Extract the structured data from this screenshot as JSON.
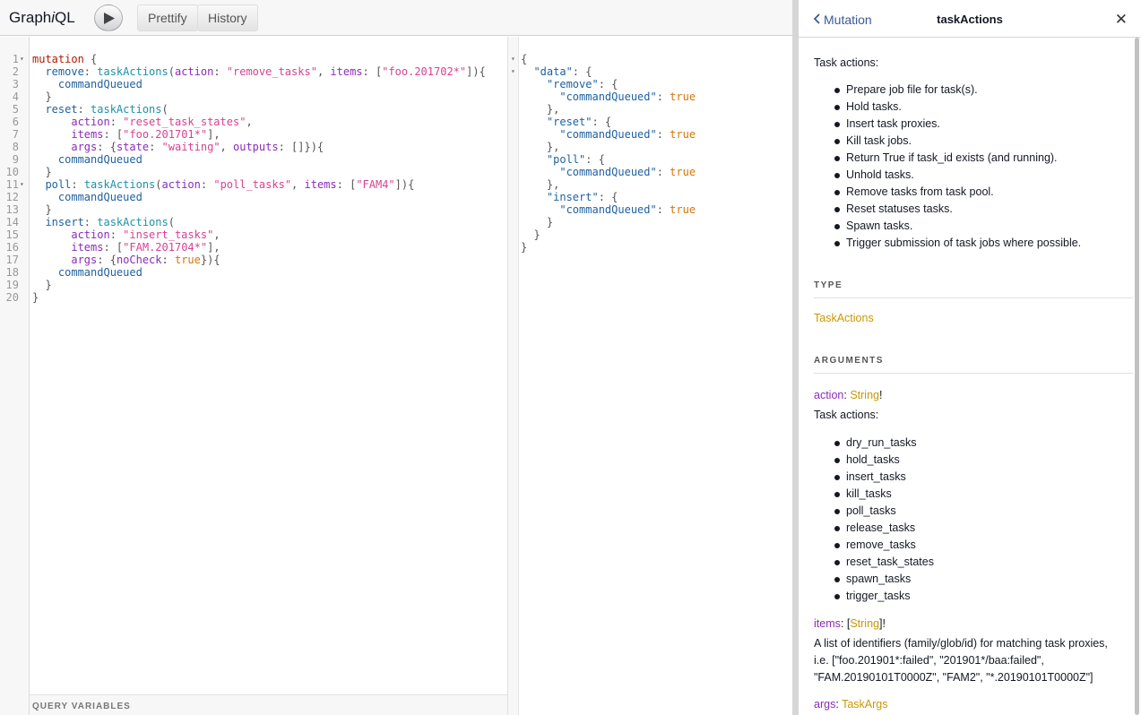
{
  "toolbar": {
    "logo_prefix": "Graph",
    "logo_italic": "i",
    "logo_suffix": "QL",
    "prettify_label": "Prettify",
    "history_label": "History"
  },
  "query": {
    "lines": [
      [
        [
          "kw",
          "mutation"
        ],
        [
          "punc",
          " {"
        ]
      ],
      [
        [
          "field",
          "  remove"
        ],
        [
          "punc",
          ": "
        ],
        [
          "fn",
          "taskActions"
        ],
        [
          "punc",
          "("
        ],
        [
          "arg",
          "action"
        ],
        [
          "punc",
          ": "
        ],
        [
          "str",
          "\"remove_tasks\""
        ],
        [
          "punc",
          ", "
        ],
        [
          "arg",
          "items"
        ],
        [
          "punc",
          ": ["
        ],
        [
          "str",
          "\"foo.201702*\""
        ],
        [
          "punc",
          "]){"
        ]
      ],
      [
        [
          "field",
          "    commandQueued"
        ]
      ],
      [
        [
          "punc",
          "  }"
        ]
      ],
      [
        [
          "field",
          "  reset"
        ],
        [
          "punc",
          ": "
        ],
        [
          "fn",
          "taskActions"
        ],
        [
          "punc",
          "("
        ]
      ],
      [
        [
          "arg",
          "      action"
        ],
        [
          "punc",
          ": "
        ],
        [
          "str",
          "\"reset_task_states\""
        ],
        [
          "punc",
          ","
        ]
      ],
      [
        [
          "arg",
          "      items"
        ],
        [
          "punc",
          ": ["
        ],
        [
          "str",
          "\"foo.201701*\""
        ],
        [
          "punc",
          "],"
        ]
      ],
      [
        [
          "arg",
          "      args"
        ],
        [
          "punc",
          ": {"
        ],
        [
          "arg",
          "state"
        ],
        [
          "punc",
          ": "
        ],
        [
          "str",
          "\"waiting\""
        ],
        [
          "punc",
          ", "
        ],
        [
          "arg",
          "outputs"
        ],
        [
          "punc",
          ": []}){"
        ]
      ],
      [
        [
          "field",
          "    commandQueued"
        ]
      ],
      [
        [
          "punc",
          "  }"
        ]
      ],
      [
        [
          "field",
          "  poll"
        ],
        [
          "punc",
          ": "
        ],
        [
          "fn",
          "taskActions"
        ],
        [
          "punc",
          "("
        ],
        [
          "arg",
          "action"
        ],
        [
          "punc",
          ": "
        ],
        [
          "str",
          "\"poll_tasks\""
        ],
        [
          "punc",
          ", "
        ],
        [
          "arg",
          "items"
        ],
        [
          "punc",
          ": ["
        ],
        [
          "str",
          "\"FAM4\""
        ],
        [
          "punc",
          "]){"
        ]
      ],
      [
        [
          "field",
          "    commandQueued"
        ]
      ],
      [
        [
          "punc",
          "  }"
        ]
      ],
      [
        [
          "field",
          "  insert"
        ],
        [
          "punc",
          ": "
        ],
        [
          "fn",
          "taskActions"
        ],
        [
          "punc",
          "("
        ]
      ],
      [
        [
          "arg",
          "      action"
        ],
        [
          "punc",
          ": "
        ],
        [
          "str",
          "\"insert_tasks\""
        ],
        [
          "punc",
          ","
        ]
      ],
      [
        [
          "arg",
          "      items"
        ],
        [
          "punc",
          ": ["
        ],
        [
          "str",
          "\"FAM.201704*\""
        ],
        [
          "punc",
          "],"
        ]
      ],
      [
        [
          "arg",
          "      args"
        ],
        [
          "punc",
          ": {"
        ],
        [
          "arg",
          "noCheck"
        ],
        [
          "punc",
          ": "
        ],
        [
          "bool",
          "true"
        ],
        [
          "punc",
          "}){"
        ]
      ],
      [
        [
          "field",
          "    commandQueued"
        ]
      ],
      [
        [
          "punc",
          "  }"
        ]
      ],
      [
        [
          "punc",
          "}"
        ]
      ]
    ],
    "folds": [
      1,
      11
    ],
    "variables_label": "QUERY VARIABLES"
  },
  "result": {
    "lines": [
      [
        [
          "punc",
          "{"
        ]
      ],
      [
        [
          "key",
          "  \"data\""
        ],
        [
          "punc",
          ": {"
        ]
      ],
      [
        [
          "key",
          "    \"remove\""
        ],
        [
          "punc",
          ": {"
        ]
      ],
      [
        [
          "key",
          "      \"commandQueued\""
        ],
        [
          "punc",
          ": "
        ],
        [
          "bool",
          "true"
        ]
      ],
      [
        [
          "punc",
          "    },"
        ]
      ],
      [
        [
          "key",
          "    \"reset\""
        ],
        [
          "punc",
          ": {"
        ]
      ],
      [
        [
          "key",
          "      \"commandQueued\""
        ],
        [
          "punc",
          ": "
        ],
        [
          "bool",
          "true"
        ]
      ],
      [
        [
          "punc",
          "    },"
        ]
      ],
      [
        [
          "key",
          "    \"poll\""
        ],
        [
          "punc",
          ": {"
        ]
      ],
      [
        [
          "key",
          "      \"commandQueued\""
        ],
        [
          "punc",
          ": "
        ],
        [
          "bool",
          "true"
        ]
      ],
      [
        [
          "punc",
          "    },"
        ]
      ],
      [
        [
          "key",
          "    \"insert\""
        ],
        [
          "punc",
          ": {"
        ]
      ],
      [
        [
          "key",
          "      \"commandQueued\""
        ],
        [
          "punc",
          ": "
        ],
        [
          "bool",
          "true"
        ]
      ],
      [
        [
          "punc",
          "    }"
        ]
      ],
      [
        [
          "punc",
          "  }"
        ]
      ],
      [
        [
          "punc",
          "}"
        ]
      ]
    ],
    "folds": [
      1,
      2
    ]
  },
  "docs": {
    "back_label": "Mutation",
    "title": "taskActions",
    "close_symbol": "✕",
    "description": "Task actions:",
    "description_items": [
      "Prepare job file for task(s).",
      "Hold tasks.",
      "Insert task proxies.",
      "Kill task jobs.",
      "Return True if task_id exists (and running).",
      "Unhold tasks.",
      "Remove tasks from task pool.",
      "Reset statuses tasks.",
      "Spawn tasks.",
      "Trigger submission of task jobs where possible."
    ],
    "type_section": "TYPE",
    "type_name": "TaskActions",
    "arguments_section": "ARGUMENTS",
    "arg_action_name": "action",
    "arg_action_type": "String",
    "arg_action_suffix": "!",
    "arg_action_desc": "Task actions:",
    "arg_action_items": [
      "dry_run_tasks",
      "hold_tasks",
      "insert_tasks",
      "kill_tasks",
      "poll_tasks",
      "release_tasks",
      "remove_tasks",
      "reset_task_states",
      "spawn_tasks",
      "trigger_tasks"
    ],
    "arg_items_name": "items",
    "arg_items_type_open": "[",
    "arg_items_type": "String",
    "arg_items_type_close": "]!",
    "arg_items_desc": "A list of identifiers (family/glob/id) for matching task proxies, i.e. [\"foo.201901*:failed\", \"201901*/baa:failed\", \"FAM.20190101T0000Z\", \"FAM2\", \"*.20190101T0000Z\"]",
    "arg_args_name": "args",
    "arg_args_type": "TaskArgs"
  },
  "colors": {
    "keyword": "#b11a04",
    "function": "#1c92a9",
    "field": "#1f61a0",
    "argument": "#8b2bb9",
    "string": "#d64292",
    "boolean": "#d47509",
    "type_link": "#ca9800",
    "back_link": "#3b5998"
  }
}
